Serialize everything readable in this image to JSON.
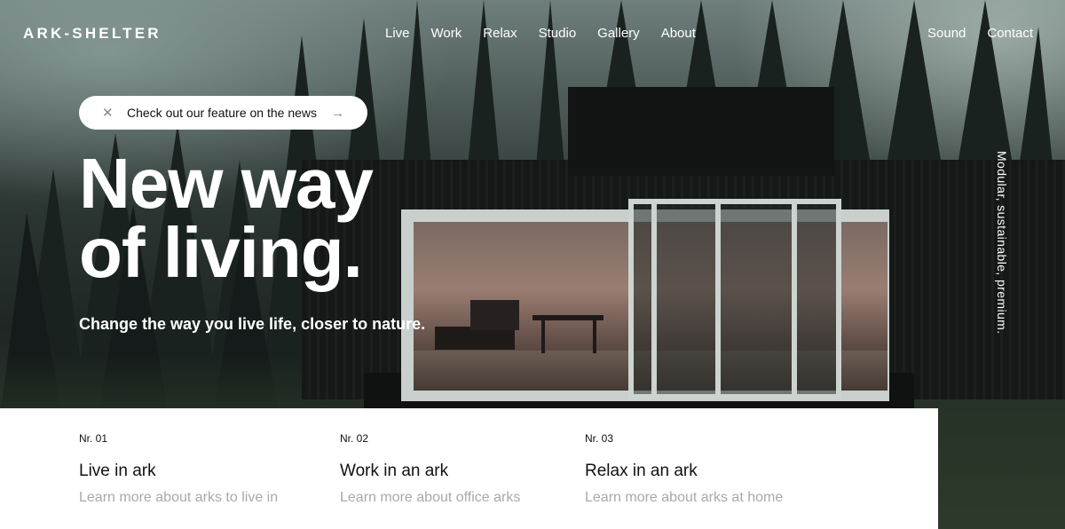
{
  "header": {
    "logo": "ARK-SHELTER",
    "nav": [
      "Live",
      "Work",
      "Relax",
      "Studio",
      "Gallery",
      "About"
    ],
    "nav_right": [
      "Sound",
      "Contact"
    ]
  },
  "announcement": {
    "text": "Check out our feature on the news",
    "close_icon": "close-icon",
    "arrow_icon": "arrow-right-icon"
  },
  "hero": {
    "headline_line1": "New way",
    "headline_line2": "of living.",
    "subheadline": "Change the way you live life, closer to nature.",
    "vertical_tag": "Modular, sustainable, premium."
  },
  "cards": [
    {
      "nr": "Nr. 01",
      "title": "Live in ark",
      "desc": "Learn more about arks to live in"
    },
    {
      "nr": "Nr. 02",
      "title": "Work in an ark",
      "desc": "Learn more about office arks"
    },
    {
      "nr": "Nr. 03",
      "title": "Relax in an ark",
      "desc": "Learn more about arks at home"
    }
  ],
  "colors": {
    "text_light": "#ffffff",
    "text_dark": "#111111",
    "muted": "#a9a9a9"
  }
}
